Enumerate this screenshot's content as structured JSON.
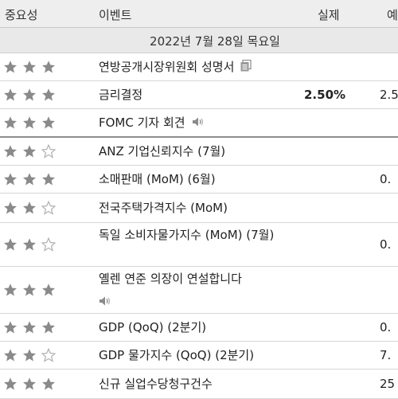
{
  "header": {
    "importance": "중요성",
    "event": "이벤트",
    "actual": "실제",
    "forecast": "예"
  },
  "date_label": "2022년 7월 28일 목요일",
  "colors": {
    "star_filled": "#8a8a8a",
    "star_empty_stroke": "#b0b0b0",
    "header_bg": "#eeeeee"
  },
  "rows": [
    {
      "stars": 3,
      "event": "연방공개시장위원회 성명서",
      "icon": "document-icon",
      "actual": "",
      "forecast": ""
    },
    {
      "stars": 3,
      "event": "금리결정",
      "icon": "",
      "actual": "2.50%",
      "forecast": "2.5"
    },
    {
      "stars": 3,
      "event": "FOMC 기자 회견",
      "icon": "speaker-icon",
      "actual": "",
      "forecast": ""
    },
    {
      "stars": 2,
      "event": "ANZ 기업신뢰지수 (7월)",
      "icon": "",
      "actual": "",
      "forecast": ""
    },
    {
      "stars": 3,
      "event": "소매판매 (MoM) (6월)",
      "icon": "",
      "actual": "",
      "forecast": "0."
    },
    {
      "stars": 2,
      "event": "전국주택가격지수 (MoM)",
      "icon": "",
      "actual": "",
      "forecast": ""
    },
    {
      "stars": 2,
      "event": "독일 소비자물가지수 (MoM) (7월)",
      "icon": "",
      "actual": "",
      "forecast": "0."
    },
    {
      "stars": 3,
      "event": "옐렌 연준 의장이 연설합니다",
      "icon": "speaker-icon",
      "actual": "",
      "forecast": ""
    },
    {
      "stars": 3,
      "event": "GDP (QoQ) (2분기)",
      "icon": "",
      "actual": "",
      "forecast": "0."
    },
    {
      "stars": 2,
      "event": "GDP 물가지수 (QoQ) (2분기)",
      "icon": "",
      "actual": "",
      "forecast": "7."
    },
    {
      "stars": 3,
      "event": "신규 실업수당청구건수",
      "icon": "",
      "actual": "",
      "forecast": "25"
    }
  ]
}
